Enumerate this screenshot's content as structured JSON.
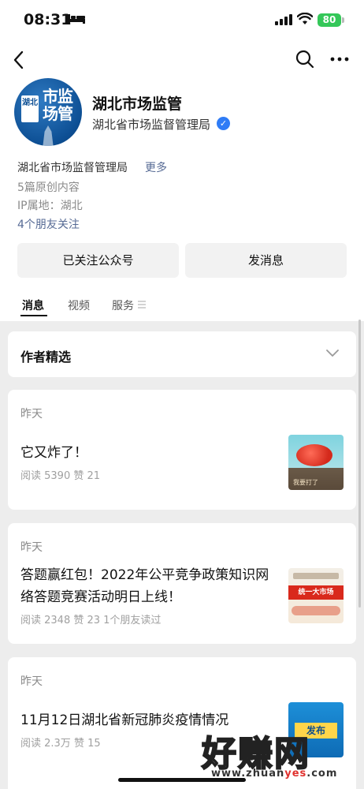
{
  "status_bar": {
    "time": "08:31",
    "battery": "80"
  },
  "account": {
    "name": "湖北市场监管",
    "org": "湖北省市场监督管理局",
    "avatar_chip": "湖北",
    "avatar_big1": "市监",
    "avatar_big2": "场管",
    "description": "湖北省市场监督管理局",
    "more_link": "更多",
    "original_count": "5篇原创内容",
    "ip_location": "IP属地：湖北",
    "friends_following": "4个朋友关注"
  },
  "actions": {
    "follow": "已关注公众号",
    "message": "发消息"
  },
  "tabs": [
    {
      "label": "消息"
    },
    {
      "label": "视频"
    },
    {
      "label": "服务"
    }
  ],
  "selection": {
    "title": "作者精选"
  },
  "articles": [
    {
      "day": "昨天",
      "title": "它又炸了！",
      "stats": "阅读 5390   赞 21",
      "thumb_caption": "我要打了"
    },
    {
      "day": "昨天",
      "title": "答题赢红包！2022年公平竞争政策知识网络答题竞赛活动明日上线！",
      "stats": "阅读 2348   赞 23   1个朋友读过",
      "thumb_caption": "统一大市场"
    },
    {
      "day": "昨天",
      "title": "11月12日湖北省新冠肺炎疫情情况",
      "stats": "阅读 2.3万   赞 15",
      "thumb_caption": "发布"
    }
  ],
  "watermark": {
    "text": "好赚网",
    "url_a": "www.zhuan",
    "url_b": "yes",
    "url_c": ".com"
  },
  "colors": {
    "link": "#576b95",
    "battery": "#34c759",
    "verified": "#2f7cf6"
  },
  "icons": [
    "back-icon",
    "search-icon",
    "more-icon",
    "menu-icon",
    "chevron-down-icon",
    "verified-icon"
  ]
}
